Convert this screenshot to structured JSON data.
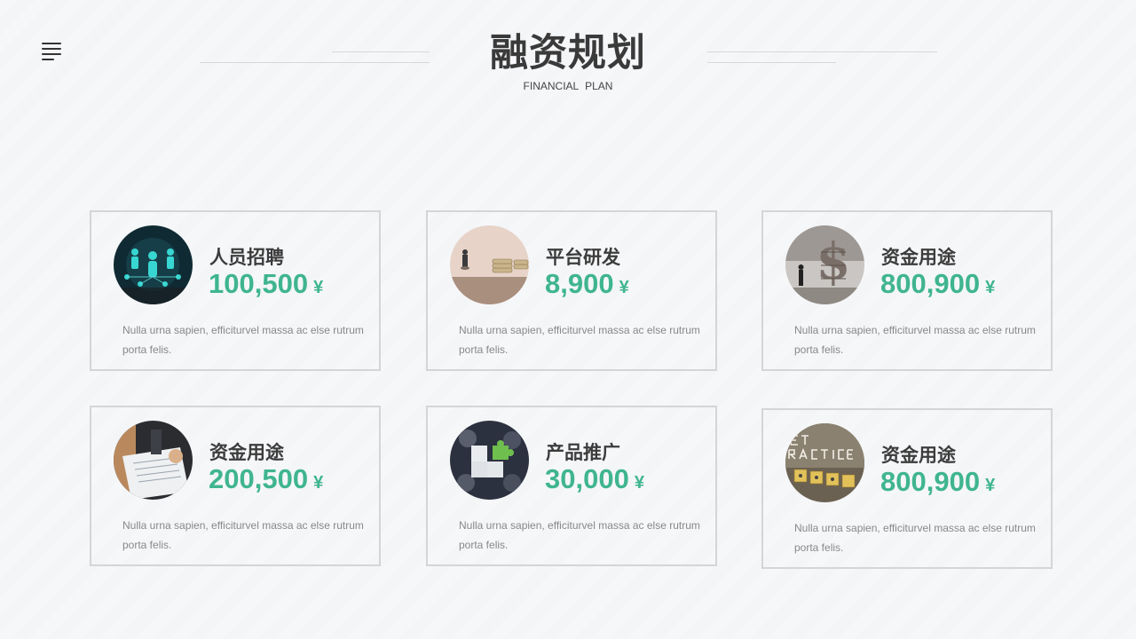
{
  "header": {
    "title": "融资规划",
    "subtitle": "FINANCIAL   PLAN",
    "menu_icon": "menu-lines-icon"
  },
  "accent_color": "#3fb58e",
  "cards": [
    {
      "title": "人员招聘",
      "amount": "100,500",
      "currency": "¥",
      "desc": "Nulla urna sapien, efficiturvel  massa ac else rutrum porta felis.",
      "image": "business-network-people"
    },
    {
      "title": "平台研发",
      "amount": "8,900",
      "currency": "¥",
      "desc": "Nulla urna sapien, efficiturvel  massa ac else rutrum porta felis.",
      "image": "miniature-man-on-coins"
    },
    {
      "title": "资金用途",
      "amount": "800,900",
      "currency": "¥",
      "desc": "Nulla urna sapien, efficiturvel  massa ac else rutrum porta felis.",
      "image": "dollar-sign-sculpture"
    },
    {
      "title": "资金用途",
      "amount": "200,500",
      "currency": "¥",
      "desc": "Nulla urna sapien, efficiturvel  massa ac else rutrum porta felis.",
      "image": "contract-signing"
    },
    {
      "title": "产品推广",
      "amount": "30,000",
      "currency": "¥",
      "desc": "Nulla urna sapien, efficiturvel  massa ac else rutrum porta felis.",
      "image": "team-puzzle-pieces"
    },
    {
      "title": "资金用途",
      "amount": "800,900",
      "currency": "¥",
      "desc": "Nulla urna sapien, efficiturvel  massa ac else rutrum porta felis.",
      "image": "best-practice-blocks"
    }
  ]
}
